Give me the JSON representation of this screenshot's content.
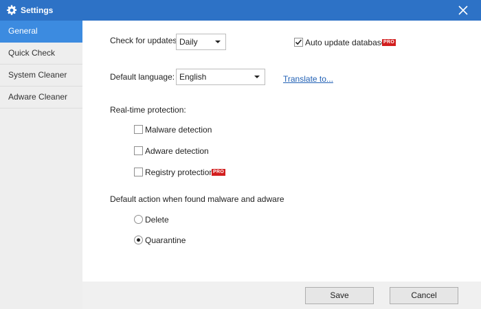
{
  "window": {
    "title": "Settings",
    "title_icon": "gear-icon",
    "close_icon": "close-icon"
  },
  "sidebar": {
    "items": [
      {
        "label": "General",
        "active": true
      },
      {
        "label": "Quick Check",
        "active": false
      },
      {
        "label": "System Cleaner",
        "active": false
      },
      {
        "label": "Adware Cleaner",
        "active": false
      }
    ]
  },
  "general": {
    "check_updates_label": "Check for updates:",
    "check_updates_value": "Daily",
    "auto_update_label": "Auto update database",
    "auto_update_checked": true,
    "default_language_label": "Default language:",
    "default_language_value": "English",
    "translate_link": "Translate to...",
    "realtime_label": "Real-time protection:",
    "malware_label": "Malware detection",
    "malware_checked": false,
    "adware_label": "Adware detection",
    "adware_checked": false,
    "registry_label": "Registry protection",
    "registry_checked": false,
    "pro_badge": "PRO",
    "default_action_label": "Default action when found malware and adware",
    "delete_label": "Delete",
    "quarantine_label": "Quarantine",
    "selected_action": "Quarantine"
  },
  "footer": {
    "save_label": "Save",
    "cancel_label": "Cancel"
  },
  "colors": {
    "titlebar": "#2d72c6",
    "sidebar_active": "#3c8be0",
    "pro_badge": "#d21e1e",
    "link": "#1f5fb4"
  }
}
